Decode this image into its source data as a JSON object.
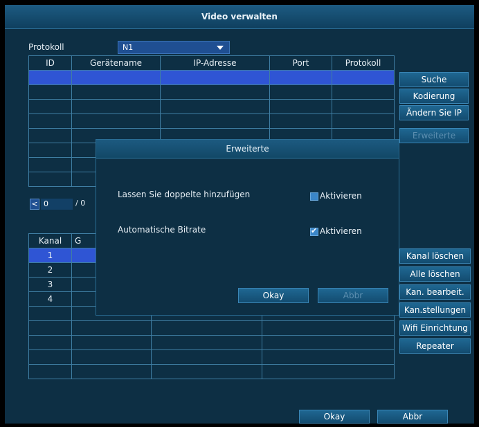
{
  "window": {
    "title": "Video verwalten"
  },
  "protocol": {
    "label": "Protokoll",
    "value": "N1"
  },
  "device_table": {
    "headers": [
      "ID",
      "Gerätename",
      "IP-Adresse",
      "Port",
      "Protokoll"
    ],
    "rows": 8
  },
  "side_buttons_top": [
    "Suche",
    "Kodierung",
    "Ändern Sie IP",
    "Erweiterte"
  ],
  "pager": {
    "prev": "<",
    "current": "0",
    "separator": "/ 0"
  },
  "channel_table": {
    "headers": [
      "Kanal",
      "G"
    ],
    "channels": [
      "1",
      "2",
      "3",
      "4"
    ]
  },
  "side_buttons_bottom": [
    "Kanal löschen",
    "Alle löschen",
    "Kan. bearbeit.",
    "Kan.stellungen",
    "Wifi Einrichtung",
    "Repeater"
  ],
  "footer": {
    "ok": "Okay",
    "cancel": "Abbr"
  },
  "dialog": {
    "title": "Erweiterte",
    "option1": {
      "label": "Lassen Sie doppelte hinzufügen",
      "checkbox": "Aktivieren",
      "checked": false
    },
    "option2": {
      "label": "Automatische Bitrate",
      "checkbox": "Aktivieren",
      "checked": true
    },
    "ok": "Okay",
    "cancel": "Abbr"
  }
}
